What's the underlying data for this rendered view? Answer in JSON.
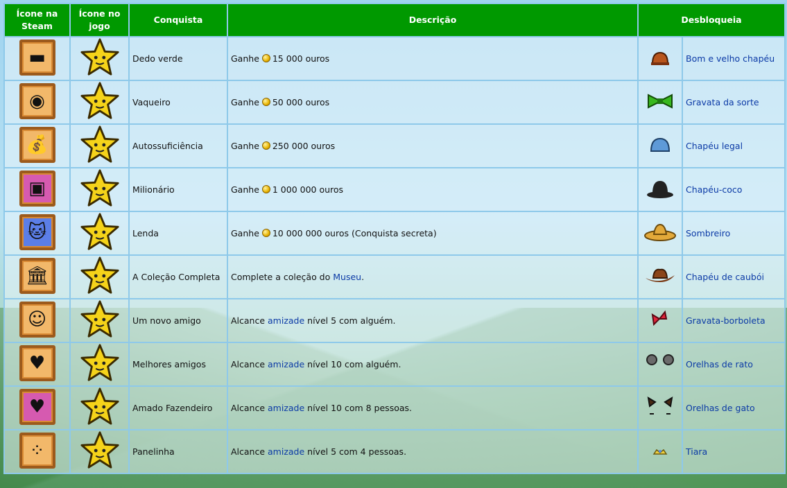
{
  "headers": {
    "steam_icon": "Ícone na Steam",
    "game_icon": "Ícone no jogo",
    "achievement": "Conquista",
    "description": "Descrição",
    "unlocks": "Desbloqueia"
  },
  "rows": [
    {
      "name": "Dedo verde",
      "desc_prefix": "Ganhe",
      "desc_link": "",
      "desc_suffix": "15 000 ouros",
      "unlock": "Bom e velho chapéu",
      "steam_icon": "gold-bars-icon",
      "unlock_icon": "old-hat-icon"
    },
    {
      "name": "Vaqueiro",
      "desc_prefix": "Ganhe",
      "desc_link": "",
      "desc_suffix": "50 000 ouros",
      "unlock": "Gravata da sorte",
      "steam_icon": "gold-coins-icon",
      "unlock_icon": "bow-tie-green-icon"
    },
    {
      "name": "Autossuficiência",
      "desc_prefix": "Ganhe",
      "desc_link": "",
      "desc_suffix": "250 000 ouros",
      "unlock": "Chapéu legal",
      "steam_icon": "money-bag-icon",
      "unlock_icon": "blue-hat-icon"
    },
    {
      "name": "Milionário",
      "desc_prefix": "Ganhe",
      "desc_link": "",
      "desc_suffix": "1 000 000 ouros",
      "unlock": "Chapéu-coco",
      "steam_icon": "treasure-chest-icon",
      "unlock_icon": "bowler-hat-icon"
    },
    {
      "name": "Lenda",
      "desc_prefix": "Ganhe",
      "desc_link": "",
      "desc_suffix": "10 000 000 ouros (Conquista secreta)",
      "unlock": "Sombreiro",
      "steam_icon": "golden-cat-icon",
      "unlock_icon": "sombrero-icon"
    },
    {
      "name": "A Coleção Completa",
      "desc_prefix": "Complete a coleção do",
      "desc_link": "Museu",
      "desc_suffix": ".",
      "unlock": "Chapéu de caubói",
      "steam_icon": "museum-icon",
      "unlock_icon": "cowboy-hat-icon"
    },
    {
      "name": "Um novo amigo",
      "desc_prefix": "Alcance",
      "desc_link": "amizade",
      "desc_suffix": "nível 5 com alguém.",
      "unlock": "Gravata-borboleta",
      "steam_icon": "smiley-icon",
      "unlock_icon": "red-bow-tie-icon"
    },
    {
      "name": "Melhores amigos",
      "desc_prefix": "Alcance",
      "desc_link": "amizade",
      "desc_suffix": "nível 10 com alguém.",
      "unlock": "Orelhas de rato",
      "steam_icon": "heart-icon",
      "unlock_icon": "mouse-ears-icon"
    },
    {
      "name": "Amado Fazendeiro",
      "desc_prefix": "Alcance",
      "desc_link": "amizade",
      "desc_suffix": "nível 10 com 8 pessoas.",
      "unlock": "Orelhas de gato",
      "steam_icon": "two-hearts-icon",
      "unlock_icon": "cat-ears-icon"
    },
    {
      "name": "Panelinha",
      "desc_prefix": "Alcance",
      "desc_link": "amizade",
      "desc_suffix": "nível 5 com 4 pessoas.",
      "unlock": "Tiara",
      "steam_icon": "four-smileys-icon",
      "unlock_icon": "tiara-icon"
    }
  ],
  "colors": {
    "header_bg": "#009900",
    "border": "#8ec9ea",
    "link": "#0b3aa6",
    "star": "#f5d31a"
  }
}
